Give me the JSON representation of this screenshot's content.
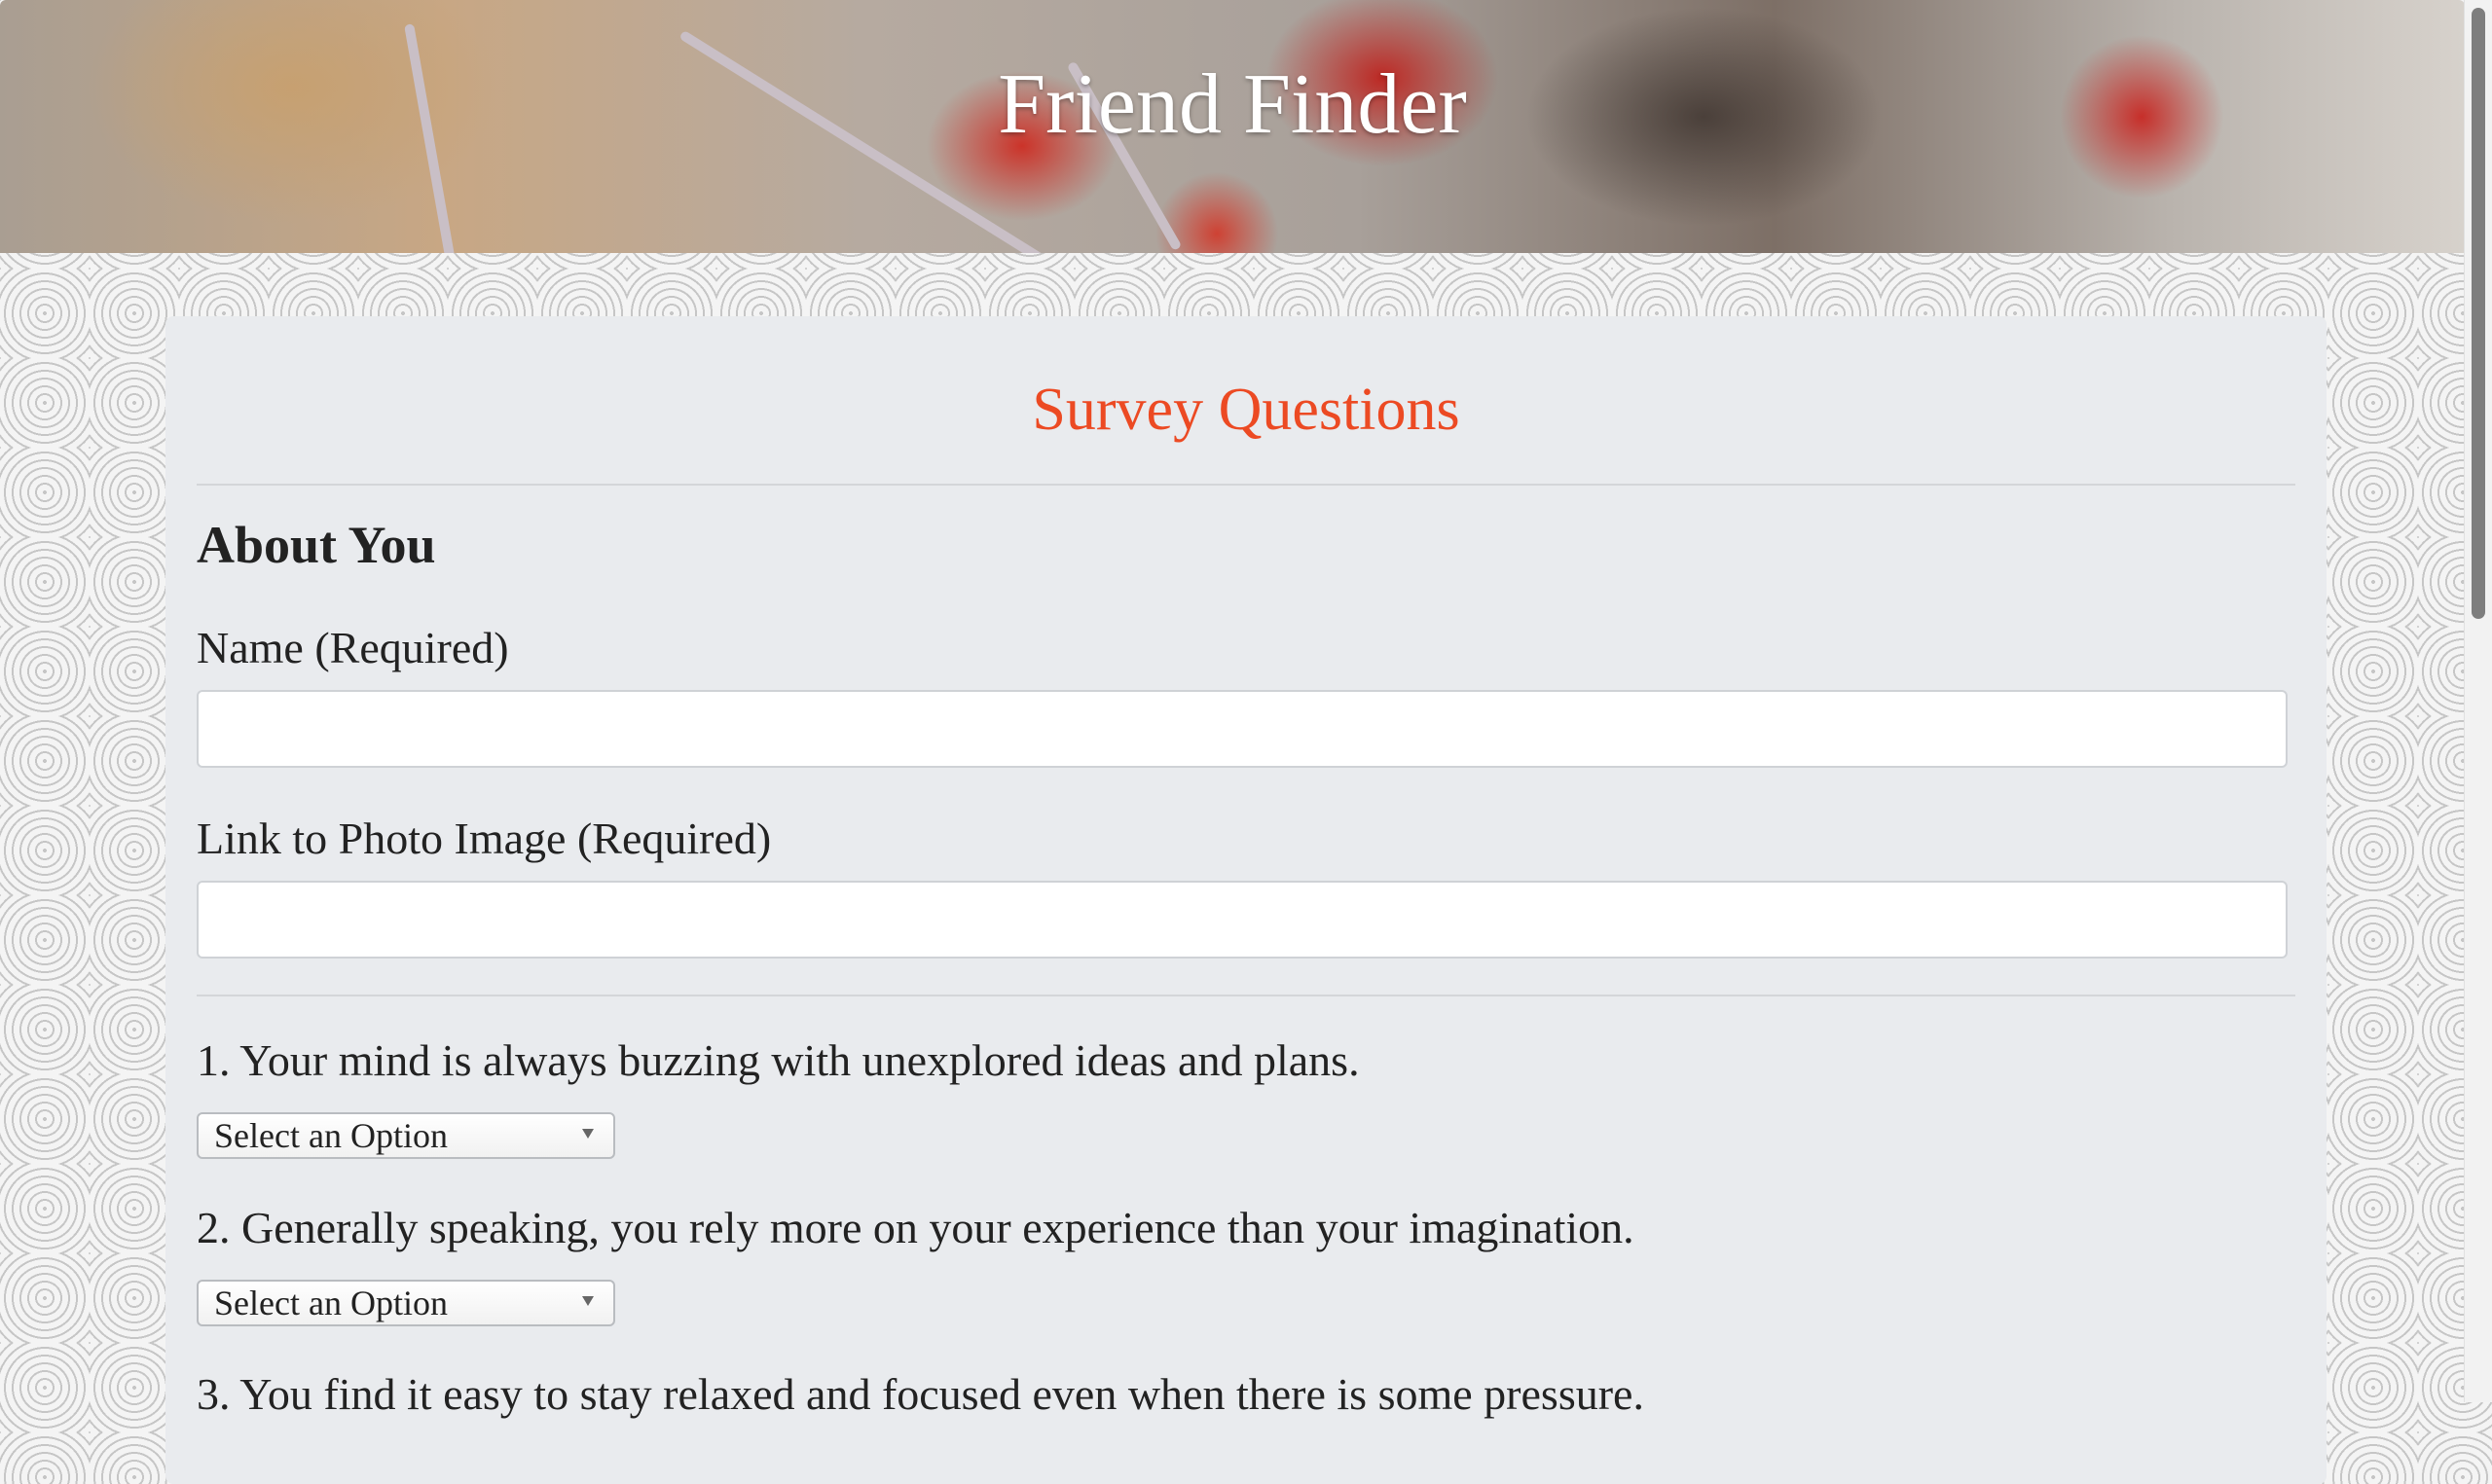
{
  "header": {
    "title": "Friend Finder"
  },
  "survey": {
    "heading": "Survey Questions",
    "about_title": "About You",
    "name_label": "Name (Required)",
    "photo_label": "Link to Photo Image (Required)",
    "questions": [
      {
        "text": "1. Your mind is always buzzing with unexplored ideas and plans.",
        "selected": "Select an Option"
      },
      {
        "text": "2. Generally speaking, you rely more on your experience than your imagination.",
        "selected": "Select an Option"
      },
      {
        "text": "3. You find it easy to stay relaxed and focused even when there is some pressure."
      }
    ]
  },
  "colors": {
    "heading_accent": "#ec4a23",
    "card_bg": "#e9ebee"
  }
}
